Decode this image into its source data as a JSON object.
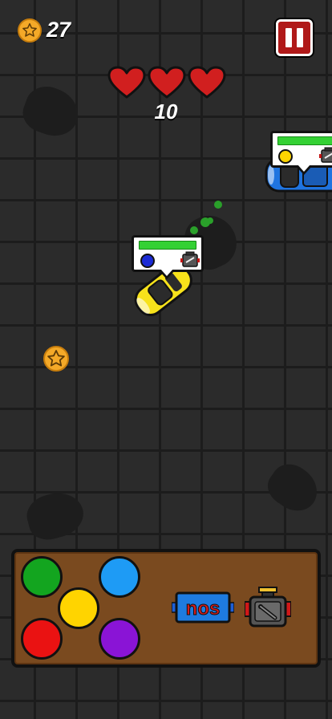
{
  "hud": {
    "coins": "27",
    "score": "10",
    "lives": 3,
    "pause_icon": "pause-icon"
  },
  "colors": {
    "heart": "#d11f1f",
    "pause": "#b01919",
    "coin": "#f4a928",
    "panel": "#7a4a1f",
    "paint_green": "#13a51f",
    "paint_blue": "#1e9bf5",
    "paint_yellow": "#ffd400",
    "paint_red": "#ea1212",
    "paint_purple": "#8a14d6"
  },
  "cars": [
    {
      "color": "yellow",
      "requested_paint": "blue",
      "repair": "engine-icon",
      "health": 1.0
    },
    {
      "color": "blue",
      "requested_paint": "yellow",
      "repair": "engine-icon",
      "health": 1.0
    }
  ],
  "toolbox": {
    "paints": [
      "green",
      "blue",
      "yellow",
      "red",
      "purple"
    ],
    "nos_label": "nos",
    "engine_icon": "engine-icon"
  }
}
